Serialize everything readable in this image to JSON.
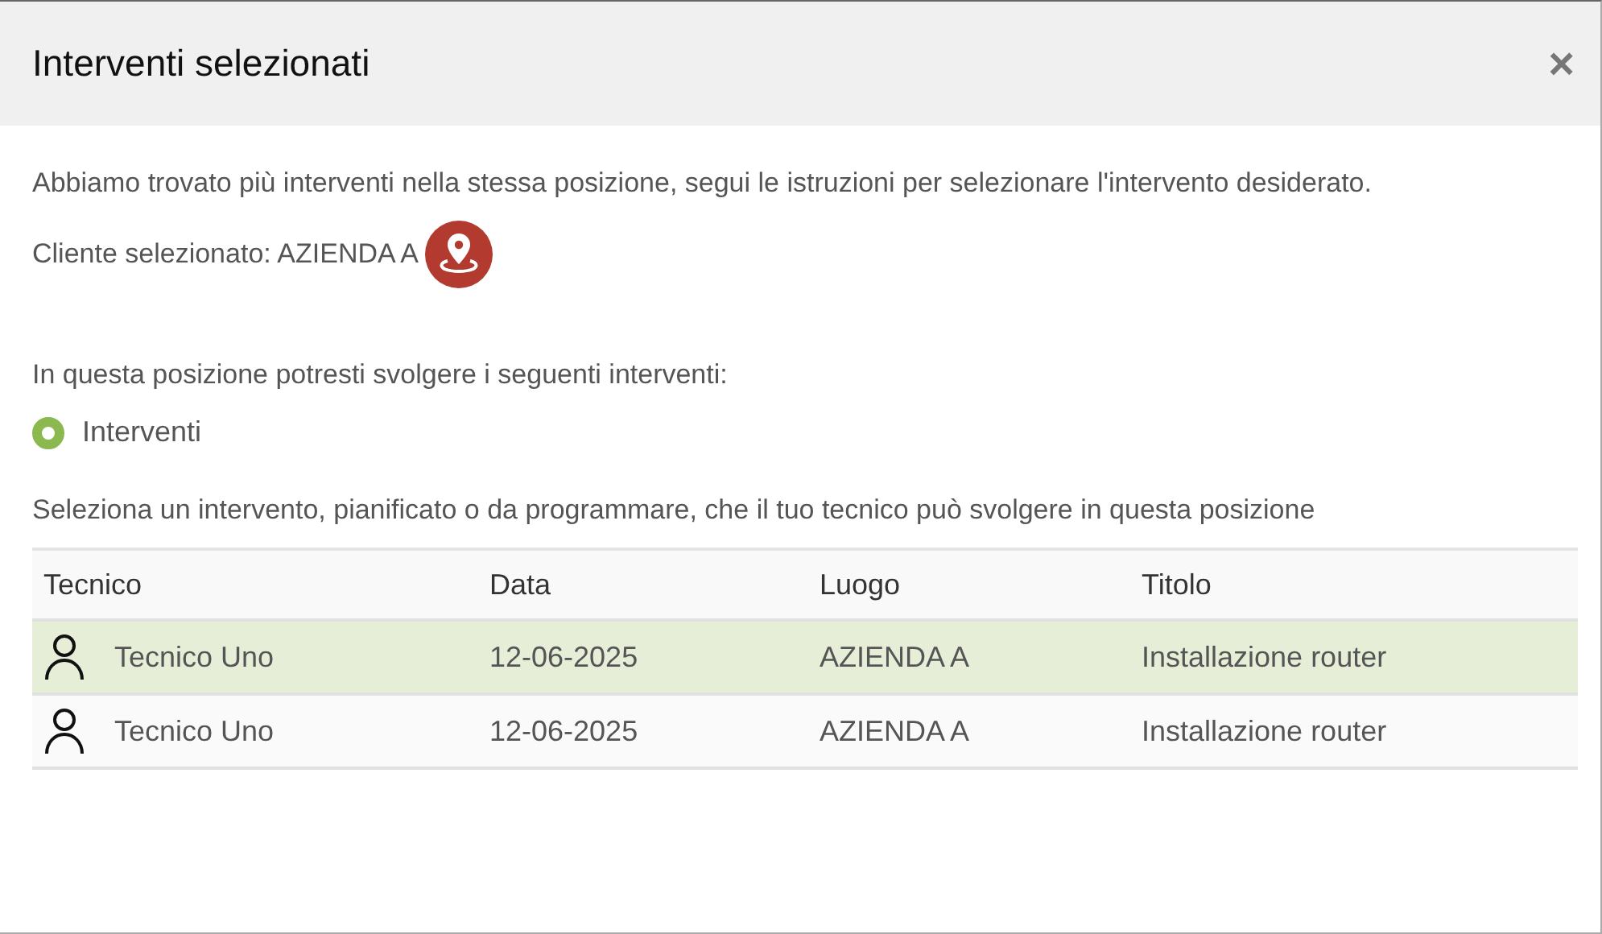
{
  "dialog": {
    "title": "Interventi selezionati",
    "close": "×"
  },
  "intro": "Abbiamo trovato più interventi nella stessa posizione, segui le istruzioni per selezionare l'intervento desiderato.",
  "client": {
    "label": "Cliente selezionato: AZIENDA A"
  },
  "options_intro": "In questa posizione potresti svolgere i seguenti interventi:",
  "options": [
    {
      "label": "Interventi",
      "selected": true
    }
  ],
  "table_intro": "Seleziona un intervento, pianificato o da programmare, che il tuo tecnico può svolgere in questa posizione",
  "table": {
    "columns": [
      "Tecnico",
      "Data",
      "Luogo",
      "Titolo"
    ],
    "rows": [
      {
        "cells": [
          "Tecnico Uno",
          "12-06-2025",
          "AZIENDA A",
          "Installazione router"
        ],
        "selected": true
      },
      {
        "cells": [
          "Tecnico Uno",
          "12-06-2025",
          "AZIENDA A",
          "Installazione router"
        ],
        "selected": false
      }
    ]
  }
}
